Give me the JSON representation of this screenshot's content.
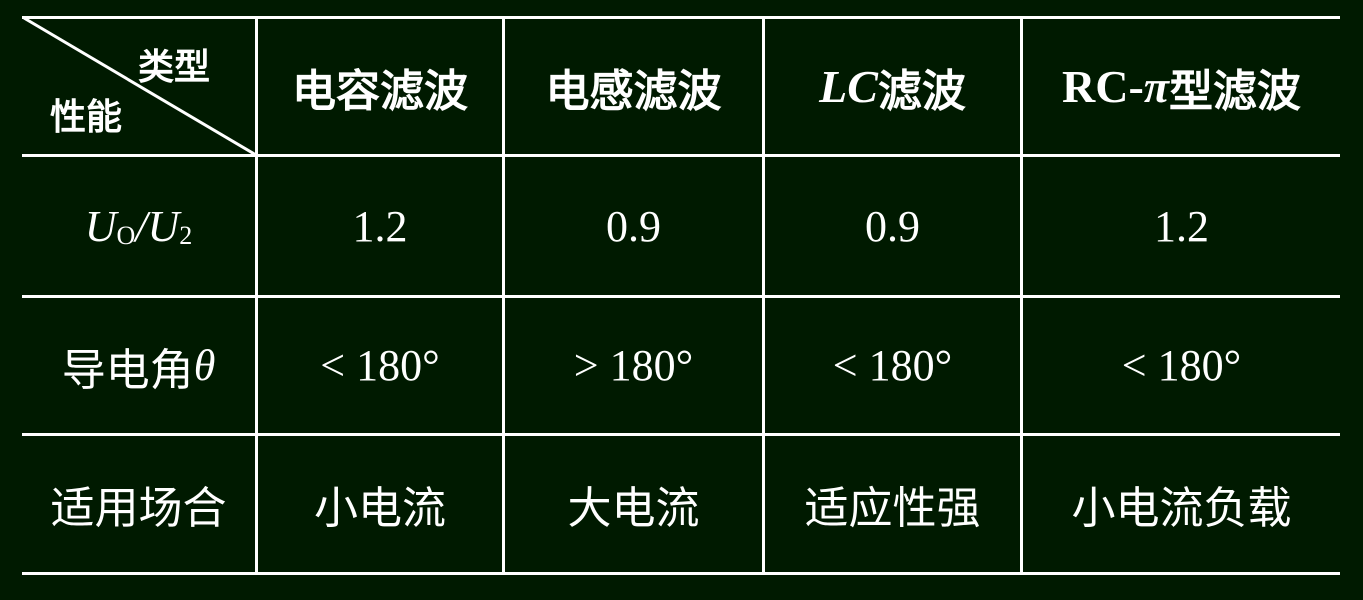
{
  "colors": {
    "background": "#001a00",
    "line": "#ffffff",
    "text": "#ffffff"
  },
  "table": {
    "corner": {
      "column_label": "类型",
      "row_label": "性能"
    },
    "headers": [
      {
        "label": "电容滤波"
      },
      {
        "label": "电感滤波"
      },
      {
        "label_latin": "LC",
        "label_cjk": "滤波"
      },
      {
        "label_latin": "RC-",
        "label_pi": "π",
        "label_cjk": "型滤波"
      }
    ],
    "rows": [
      {
        "label_main": "U",
        "label_sub1": "O",
        "label_sep": "/U",
        "label_sub2": "2",
        "values": [
          "1.2",
          "0.9",
          "0.9",
          "1.2"
        ]
      },
      {
        "label_cjk": "导电角",
        "label_symbol": "θ",
        "values": [
          "< 180°",
          "> 180°",
          "< 180°",
          "< 180°"
        ]
      },
      {
        "label": "适用场合",
        "values": [
          "小电流",
          "大电流",
          "适应性强",
          "小电流负载"
        ]
      }
    ]
  }
}
